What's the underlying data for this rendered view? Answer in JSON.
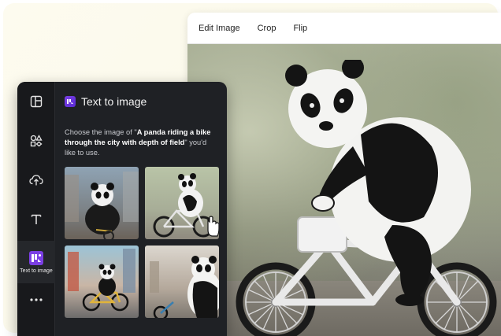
{
  "toolbar": {
    "items": [
      "Edit Image",
      "Crop",
      "Flip"
    ]
  },
  "panel": {
    "title": "Text to image",
    "desc_prefix": "Choose the image of \"",
    "prompt": "A panda riding a bike through the city with depth of field",
    "desc_suffix": "\" you'd like to use."
  },
  "rail": {
    "items": [
      {
        "icon": "layout-icon",
        "label": ""
      },
      {
        "icon": "elements-icon",
        "label": ""
      },
      {
        "icon": "upload-cloud-icon",
        "label": ""
      },
      {
        "icon": "text-icon",
        "label": ""
      },
      {
        "icon": "text-to-image-icon",
        "label": "Text to image"
      },
      {
        "icon": "more-icon",
        "label": ""
      }
    ]
  },
  "colors": {
    "panel_bg": "#1f2125",
    "rail_bg": "#18191c",
    "accent": "#7b3fe4",
    "frame_bg": "#fdfbef"
  }
}
